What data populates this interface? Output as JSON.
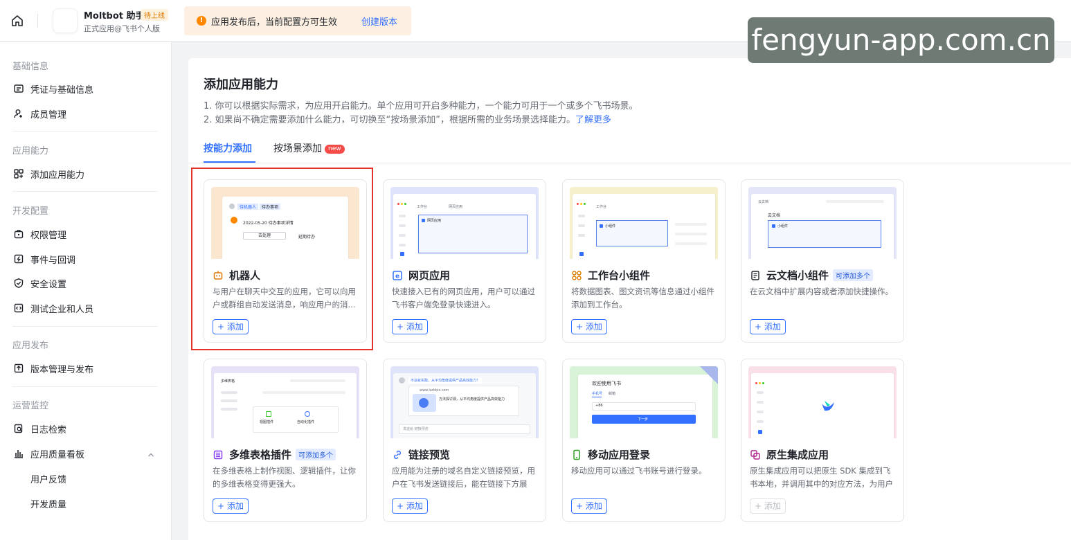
{
  "topbar": {
    "app_name": "Moltbot 助手",
    "app_status": "待上线",
    "app_sub": "正式应用@飞书个人版",
    "notice_text": "应用发布后，当前配置方可生效",
    "notice_link": "创建版本",
    "notice_icon": "!"
  },
  "watermark": "fengyun-app.com.cn",
  "sidebar": {
    "groups": [
      "基础信息",
      "应用能力",
      "开发配置",
      "应用发布",
      "运营监控"
    ],
    "items": [
      {
        "label": "凭证与基础信息",
        "icon": "credential-icon"
      },
      {
        "label": "成员管理",
        "icon": "member-icon"
      },
      {
        "label": "添加应用能力",
        "icon": "add-capability-icon"
      },
      {
        "label": "权限管理",
        "icon": "permission-icon"
      },
      {
        "label": "事件与回调",
        "icon": "event-icon"
      },
      {
        "label": "安全设置",
        "icon": "security-icon"
      },
      {
        "label": "测试企业和人员",
        "icon": "test-icon"
      },
      {
        "label": "版本管理与发布",
        "icon": "version-icon"
      },
      {
        "label": "日志检索",
        "icon": "log-icon"
      },
      {
        "label": "应用质量看板",
        "icon": "chart-icon"
      },
      {
        "label": "用户反馈",
        "icon": ""
      },
      {
        "label": "开发质量",
        "icon": ""
      }
    ]
  },
  "main": {
    "title": "添加应用能力",
    "desc1": "1. 你可以根据实际需求，为应用开启能力。单个应用可开启多种能力，一个能力可用于一个或多个飞书场景。",
    "desc2": "2. 如果尚不确定需要添加什么能力，可切换至“按场景添加”，根据所需的业务场景选择能力。",
    "desc2_link": "了解更多",
    "tabs": [
      {
        "label": "按能力添加"
      },
      {
        "label": "按场景添加",
        "badge": "new"
      }
    ],
    "add_label": "+ 添加",
    "cards": [
      {
        "title": "机器人",
        "icon": "robot-icon",
        "tag": "",
        "desc": "与用户在聊天中交互的应用，它可以向用户或群组自动发送消息，响应用户的消...",
        "disabled": false
      },
      {
        "title": "网页应用",
        "icon": "web-app-icon",
        "tag": "",
        "desc": "快速接入已有的网页应用，用户可以通过飞书客户端免登录快速进入。",
        "disabled": false
      },
      {
        "title": "工作台小组件",
        "icon": "widget-icon",
        "tag": "",
        "desc": "将数据图表、图文资讯等信息通过小组件添加到工作台。",
        "disabled": false
      },
      {
        "title": "云文档小组件",
        "icon": "doc-icon",
        "tag": "可添加多个",
        "desc": "在云文档中扩展内容或者添加快捷操作。",
        "disabled": false
      },
      {
        "title": "多维表格插件",
        "icon": "table-icon",
        "tag": "可添加多个",
        "desc": "在多维表格上制作视图、逻辑插件，让你的多维表格变得更强大。",
        "disabled": false
      },
      {
        "title": "链接预览",
        "icon": "link-icon",
        "tag": "",
        "desc": "应用能为注册的域名自定义链接预览，用户在飞书发送链接后，能在链接下方展示...",
        "disabled": false
      },
      {
        "title": "移动应用登录",
        "icon": "mobile-icon",
        "tag": "",
        "desc": "移动应用可以通过飞书账号进行登录。",
        "disabled": false
      },
      {
        "title": "原生集成应用",
        "icon": "native-icon",
        "tag": "",
        "desc": "原生集成应用可以把原生 SDK 集成到飞书本地，并调用其中的对应方法，为用户提...",
        "disabled": true
      }
    ]
  },
  "previews": {
    "bot_chip1": "待机器人",
    "bot_chip2": "待办事项",
    "bot_line": "2022-05-20 待办事项详情",
    "bot_btn1": "去处理",
    "bot_btn2": "延期待办",
    "web_tab1": "工作台",
    "web_tab2": "网页应用",
    "web_label": "网页应用",
    "widget_tab": "工作台",
    "widget_label": "小组件",
    "doc_back": "云文档",
    "doc_title": "云文档",
    "doc_label": "小组件",
    "table_title": "多维表格",
    "table_plugin1": "视图插件",
    "table_plugin2": "自动化插件",
    "link_question": "不这就实践，从平均角度提供产品高效能力？",
    "link_url": "www.larkbiz.com",
    "link_preview_text": "方法探讨源，从平均角度提供产品高效能力",
    "link_input": "发送给 链接预览",
    "mobile_welcome": "欢迎使用飞书",
    "mobile_tab1": "手机号",
    "mobile_tab2": "邮箱",
    "mobile_code": "+86",
    "mobile_next": "下一步"
  },
  "colors": {
    "brand": "#3370ff",
    "highlight": "#e5322d",
    "notice_bg": "#fdf0e2",
    "warn": "#ff8800",
    "new_badge": "#f54a45",
    "watermark_bg": "#6f7a74"
  }
}
